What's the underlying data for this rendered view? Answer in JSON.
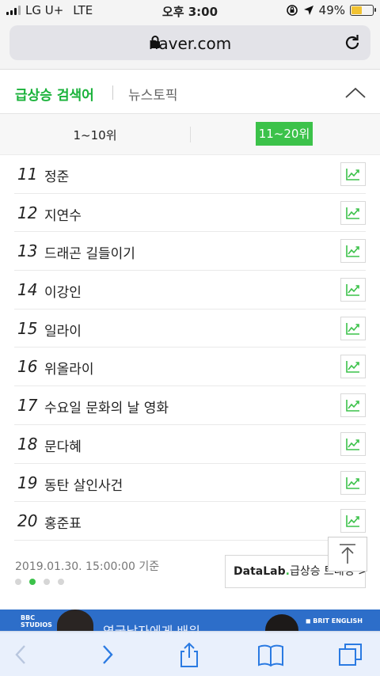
{
  "status_bar": {
    "carrier": "LG U+",
    "network": "LTE",
    "time": "오후 3:00",
    "battery_percent": "49%",
    "battery_level": 0.49
  },
  "browser": {
    "domain": "naver.com"
  },
  "header": {
    "tab_active": "급상승 검색어",
    "tab_inactive": "뉴스토픽"
  },
  "range_tabs": {
    "first": "1~10위",
    "second": "11~20위",
    "active": "second"
  },
  "keywords": [
    {
      "rank": "11",
      "term": "정준"
    },
    {
      "rank": "12",
      "term": "지연수"
    },
    {
      "rank": "13",
      "term": "드래곤 길들이기"
    },
    {
      "rank": "14",
      "term": "이강인"
    },
    {
      "rank": "15",
      "term": "일라이"
    },
    {
      "rank": "16",
      "term": "위올라이"
    },
    {
      "rank": "17",
      "term": "수요일 문화의 날 영화"
    },
    {
      "rank": "18",
      "term": "문다혜"
    },
    {
      "rank": "19",
      "term": "동탄 살인사건"
    },
    {
      "rank": "20",
      "term": "홍준표"
    }
  ],
  "footer": {
    "base_time": "2019.01.30. 15:00:00 기준",
    "datalab_brand": "DataLab",
    "datalab_dot": ".",
    "datalab_label": "급상승 트래킹 >",
    "page_count": 4,
    "active_page": 2
  },
  "banner": {
    "studios_line1": "BBC",
    "studios_line2": "STUDIOS",
    "text": "영국남자에게 배워",
    "brand": "◼ BRIT ENGLISH"
  },
  "colors": {
    "accent_green": "#19b23a",
    "tab_green": "#3cc24a",
    "toolbar_blue": "#2a7ae2",
    "banner_blue": "#2d6ec9"
  }
}
